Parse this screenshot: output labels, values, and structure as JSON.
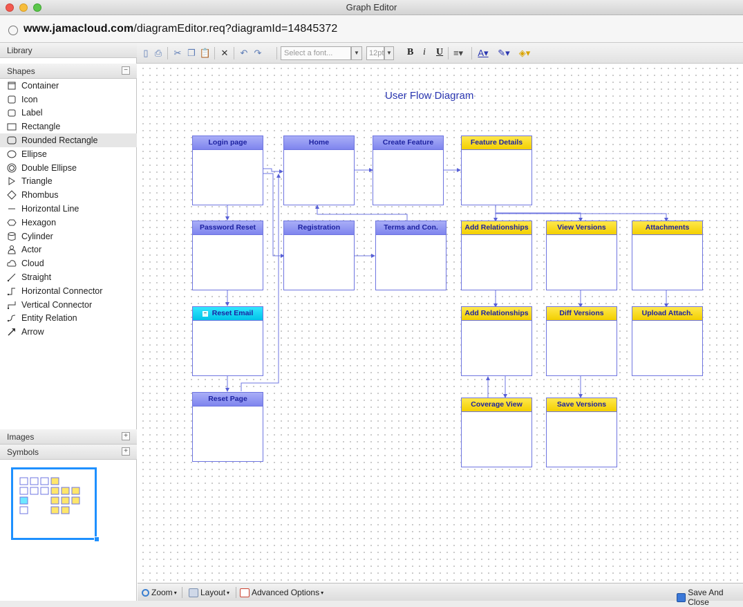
{
  "window": {
    "title": "Graph Editor"
  },
  "urlbar": {
    "host": "www.jamacloud.com",
    "path": "/diagramEditor.req?diagramId=14845372"
  },
  "library": {
    "header": "Library",
    "shapes_header": "Shapes",
    "shapes_toggle": "−",
    "shapes": [
      {
        "label": "Container",
        "icon": "container-icon"
      },
      {
        "label": "Icon",
        "icon": "rounded-square-icon"
      },
      {
        "label": "Label",
        "icon": "label-icon"
      },
      {
        "label": "Rectangle",
        "icon": "rectangle-icon"
      },
      {
        "label": "Rounded Rectangle",
        "icon": "rounded-rectangle-icon",
        "selected": true
      },
      {
        "label": "Ellipse",
        "icon": "ellipse-icon"
      },
      {
        "label": "Double Ellipse",
        "icon": "double-ellipse-icon"
      },
      {
        "label": "Triangle",
        "icon": "triangle-icon"
      },
      {
        "label": "Rhombus",
        "icon": "rhombus-icon"
      },
      {
        "label": "Horizontal Line",
        "icon": "horizontal-line-icon"
      },
      {
        "label": "Hexagon",
        "icon": "hexagon-icon"
      },
      {
        "label": "Cylinder",
        "icon": "cylinder-icon"
      },
      {
        "label": "Actor",
        "icon": "actor-icon"
      },
      {
        "label": "Cloud",
        "icon": "cloud-icon"
      },
      {
        "label": "Straight",
        "icon": "straight-connector-icon"
      },
      {
        "label": "Horizontal Connector",
        "icon": "horizontal-connector-icon"
      },
      {
        "label": "Vertical Connector",
        "icon": "vertical-connector-icon"
      },
      {
        "label": "Entity Relation",
        "icon": "entity-relation-icon"
      },
      {
        "label": "Arrow",
        "icon": "arrow-icon"
      }
    ],
    "images_header": "Images",
    "images_toggle": "+",
    "symbols_header": "Symbols",
    "symbols_toggle": "+"
  },
  "toolbar": {
    "font_placeholder": "Select a font...",
    "font_size": "12pt",
    "bold": "B",
    "italic": "i",
    "underline": "U"
  },
  "diagram": {
    "title": "User Flow Diagram",
    "nodes": {
      "login_page": "Login page",
      "home": "Home",
      "create_feature": "Create Feature",
      "feature_details": "Feature Details",
      "password_reset": "Password Reset",
      "registration": "Registration",
      "terms": "Terms and Con.",
      "add_relationships_1": "Add Relationships",
      "view_versions": "View Versions",
      "attachments": "Attachments",
      "reset_email": "Reset Email",
      "add_relationships_2": "Add Relationships",
      "diff_versions": "Diff Versions",
      "upload_attach": "Upload Attach.",
      "reset_page": "Reset Page",
      "coverage_view": "Coverage View",
      "save_versions": "Save Versions"
    },
    "colors": {
      "blue_header": "#8f94f2",
      "yellow_header": "#f7d600",
      "cyan_header": "#00d2f0",
      "border": "#6d74e0"
    }
  },
  "statusbar": {
    "zoom": "Zoom",
    "layout": "Layout",
    "advanced": "Advanced Options",
    "save_close": "Save And Close"
  }
}
